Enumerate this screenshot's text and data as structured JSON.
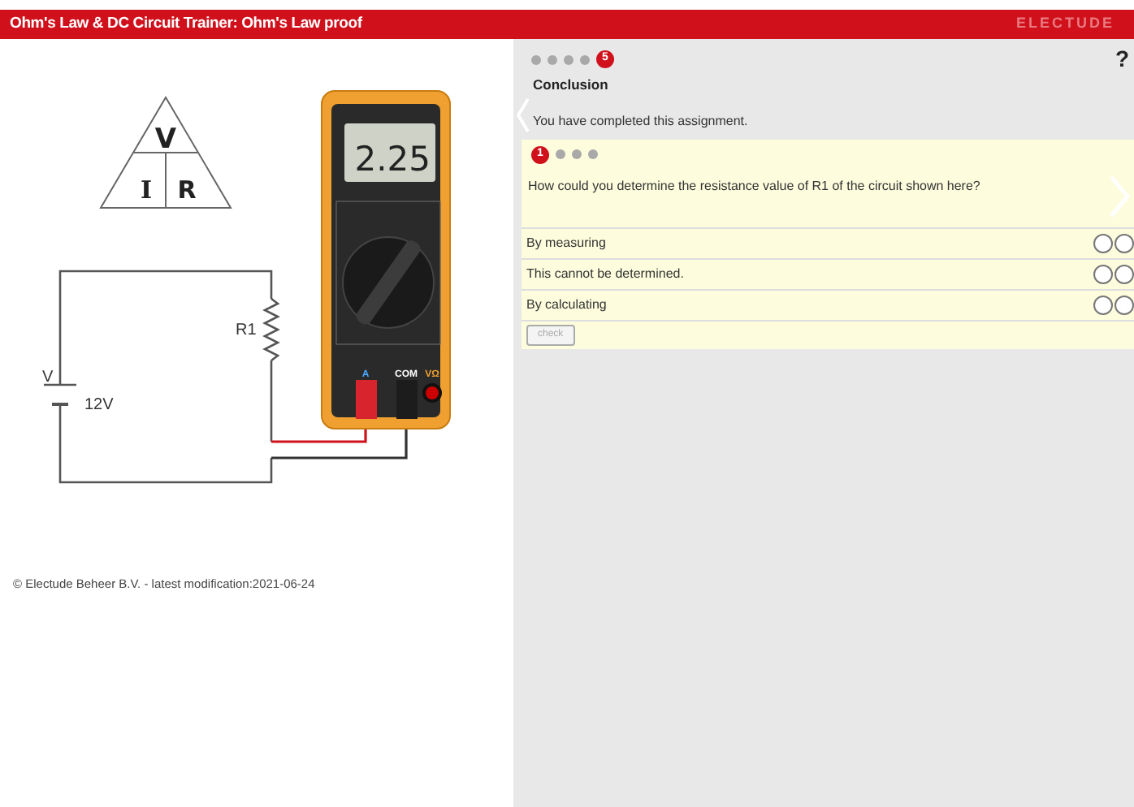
{
  "header": {
    "title": "Ohm's Law & DC Circuit Trainer: Ohm's Law proof",
    "logo": "ELECTUDE"
  },
  "formula_triangle": {
    "top": "V",
    "bottom_left": "I",
    "bottom_right": "R"
  },
  "circuit": {
    "resistor_label": "R1",
    "source_label": "V",
    "source_value": "12V"
  },
  "multimeter": {
    "reading": "2.25",
    "ports": [
      "A",
      "COM",
      "VΩ"
    ]
  },
  "footer": "© Electude Beheer B.V. - latest modification:2021-06-24",
  "step_nav": {
    "current": "5",
    "steps": [
      {
        "selected": false
      },
      {
        "selected": false
      },
      {
        "selected": false
      },
      {
        "selected": false
      },
      {
        "selected": true
      }
    ]
  },
  "help_mark": "?",
  "section": {
    "title": "Conclusion",
    "text": "You have completed this assignment."
  },
  "question": {
    "current": "1",
    "steps": [
      {
        "selected": true
      },
      {
        "selected": false
      },
      {
        "selected": false
      },
      {
        "selected": false
      }
    ],
    "text": "How could you determine the resistance value of R1 of the circuit shown here?",
    "options": [
      {
        "label": "By measuring",
        "radios": [
          {
            "checked": false
          },
          {
            "checked": false
          }
        ]
      },
      {
        "label": "This cannot be determined.",
        "radios": [
          {
            "checked": false
          },
          {
            "checked": false
          }
        ]
      },
      {
        "label": "By calculating",
        "radios": [
          {
            "checked": false
          },
          {
            "checked": false
          }
        ]
      }
    ],
    "check_button": {
      "label": "check",
      "disabled": true
    }
  }
}
